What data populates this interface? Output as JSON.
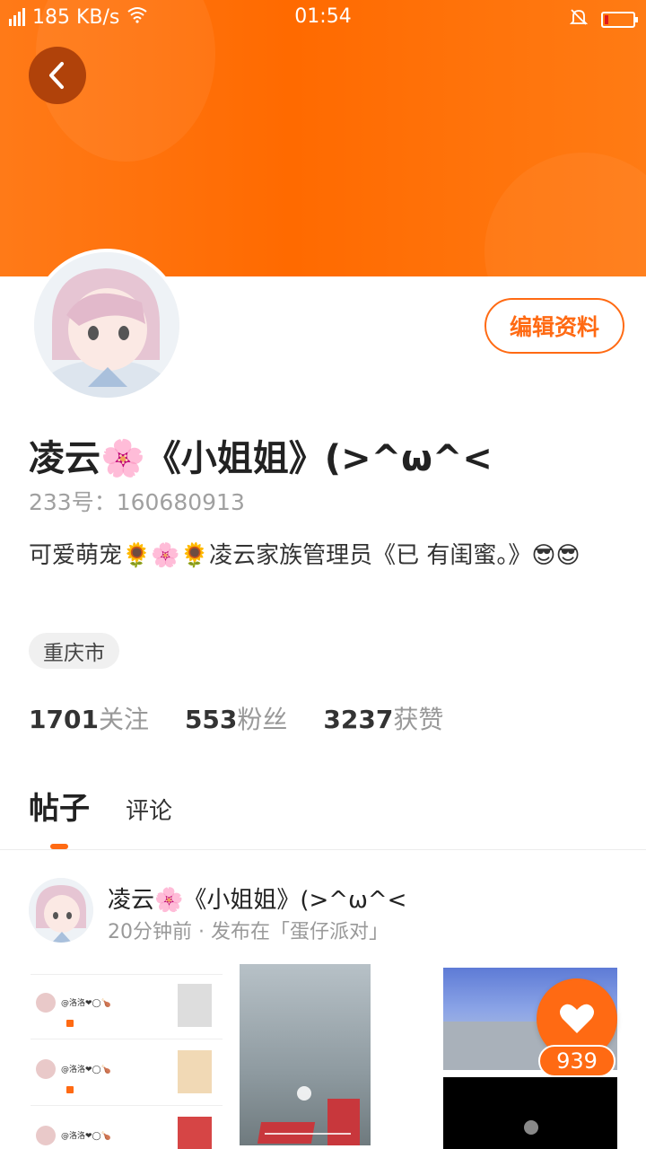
{
  "status_bar": {
    "network_speed": "185 KB/s",
    "time": "01:54",
    "icons": [
      "signal-icon",
      "wifi-icon",
      "mute-icon",
      "battery-icon"
    ]
  },
  "profile": {
    "nickname": "凌云🌸《小姐姐》(>^ω^<",
    "uid": "233号：160680913",
    "bio": "可爱萌宠🌻🌸🌻凌云家族管理员《已 有闺蜜。》😎😎",
    "location": "重庆市",
    "edit_label": "编辑资料"
  },
  "stats": {
    "following_count": "1701",
    "following_label": "关注",
    "fans_count": "553",
    "fans_label": "粉丝",
    "likes_count": "3237",
    "likes_label": "获赞"
  },
  "tabs": {
    "posts": "帖子",
    "comments": "评论"
  },
  "post": {
    "author": "凌云🌸《小姐姐》(>^ω^<",
    "meta": "20分钟前 · 发布在「蛋仔派对」",
    "like_count": "939",
    "thumb_rows": [
      {
        "name": "@洛洛❤◯🍗"
      },
      {
        "name": "@洛洛❤◯🍗"
      },
      {
        "name": "@洛洛❤◯🍗"
      }
    ]
  },
  "colors": {
    "accent": "#ff6a13",
    "header_gradient_start": "#ff7a18",
    "header_gradient_end": "#ff7b14"
  }
}
